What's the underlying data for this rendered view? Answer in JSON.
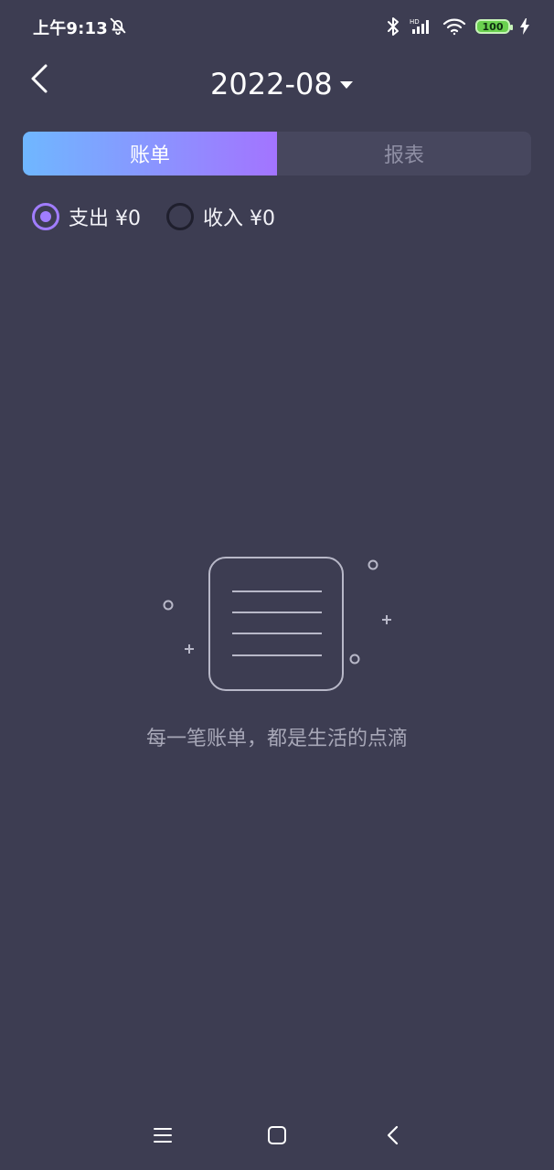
{
  "status_bar": {
    "time": "上午9:13",
    "battery": "100"
  },
  "header": {
    "month": "2022-08"
  },
  "tabs": [
    {
      "label": "账单",
      "active": true
    },
    {
      "label": "报表",
      "active": false
    }
  ],
  "filters": {
    "expense": {
      "label": "支出 ¥0",
      "checked": true
    },
    "income": {
      "label": "收入 ¥0",
      "checked": false
    }
  },
  "empty_state": {
    "message": "每一笔账单，都是生活的点滴"
  },
  "icons": {
    "back": "chevron-left-icon",
    "dropdown": "caret-down-icon",
    "bluetooth": "bluetooth-icon",
    "signal": "signal-icon",
    "wifi": "wifi-icon",
    "battery": "battery-icon",
    "charging": "charging-icon",
    "do_not_disturb": "bell-off-icon",
    "menu": "menu-icon",
    "home": "home-icon",
    "nav_back": "nav-back-icon"
  },
  "colors": {
    "background": "#3d3d52",
    "accent_start": "#6fb7ff",
    "accent_end": "#a374ff",
    "radio_checked": "#a17dff",
    "battery_green": "#6ad14f"
  }
}
